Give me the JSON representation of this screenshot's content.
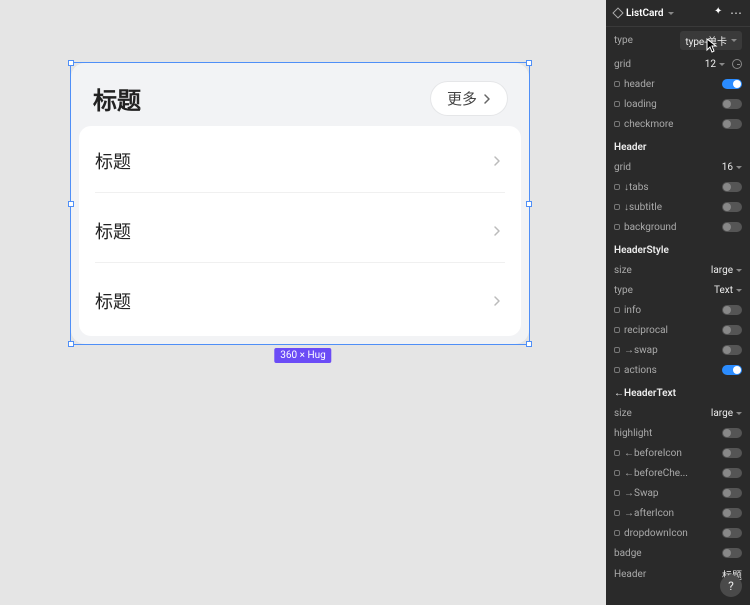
{
  "canvas": {
    "card": {
      "title": "标题",
      "more_label": "更多",
      "items": [
        {
          "title": "标题"
        },
        {
          "title": "标题"
        },
        {
          "title": "标题"
        }
      ]
    },
    "dimension_badge": "360 × Hug"
  },
  "panel": {
    "component_name": "ListCard",
    "props": [
      {
        "key": "type",
        "label": "type",
        "value": "type-单卡",
        "control": "select",
        "icon": null
      },
      {
        "key": "grid",
        "label": "grid",
        "value": "12",
        "control": "select_clock",
        "icon": null
      },
      {
        "key": "header",
        "label": "header",
        "value": true,
        "control": "toggle",
        "icon": "link"
      },
      {
        "key": "loading",
        "label": "loading",
        "value": false,
        "control": "toggle",
        "icon": "link"
      },
      {
        "key": "checkmore",
        "label": "checkmore",
        "value": false,
        "control": "toggle",
        "icon": "link"
      }
    ],
    "sections": [
      {
        "title": "Header",
        "props": [
          {
            "key": "h_grid",
            "label": "grid",
            "value": "16",
            "control": "select",
            "icon": null
          },
          {
            "key": "tabs",
            "label": "↓tabs",
            "value": false,
            "control": "toggle",
            "icon": "link"
          },
          {
            "key": "subtitle",
            "label": "↓subtitle",
            "value": false,
            "control": "toggle",
            "icon": "link"
          },
          {
            "key": "background",
            "label": "background",
            "value": false,
            "control": "toggle",
            "icon": "link"
          }
        ]
      },
      {
        "title": "HeaderStyle",
        "props": [
          {
            "key": "hs_size",
            "label": "size",
            "value": "large",
            "control": "select",
            "icon": null
          },
          {
            "key": "hs_type",
            "label": "type",
            "value": "Text",
            "control": "select",
            "icon": null
          },
          {
            "key": "info",
            "label": "info",
            "value": false,
            "control": "toggle",
            "icon": "link"
          },
          {
            "key": "reciprocal",
            "label": "reciprocal",
            "value": false,
            "control": "toggle",
            "icon": "link"
          },
          {
            "key": "swap",
            "label": "→swap",
            "value": false,
            "control": "toggle",
            "icon": "link"
          },
          {
            "key": "actions",
            "label": "actions",
            "value": true,
            "control": "toggle",
            "icon": "link"
          }
        ]
      },
      {
        "title": "←HeaderText",
        "props": [
          {
            "key": "ht_size",
            "label": "size",
            "value": "large",
            "control": "select",
            "icon": null
          },
          {
            "key": "highlight",
            "label": "highlight",
            "value": false,
            "control": "toggle",
            "icon": null
          },
          {
            "key": "beforeIcon",
            "label": "←beforeIcon",
            "value": false,
            "control": "toggle",
            "icon": "link"
          },
          {
            "key": "beforeChe",
            "label": "←beforeChe...",
            "value": false,
            "control": "toggle",
            "icon": "link"
          },
          {
            "key": "Swap",
            "label": "→Swap",
            "value": false,
            "control": "toggle",
            "icon": "link"
          },
          {
            "key": "afterIcon",
            "label": "→afterIcon",
            "value": false,
            "control": "toggle",
            "icon": "link"
          },
          {
            "key": "dropdownIcon",
            "label": "dropdownIcon",
            "value": false,
            "control": "toggle",
            "icon": "link"
          },
          {
            "key": "badge",
            "label": "badge",
            "value": false,
            "control": "toggle",
            "icon": null
          },
          {
            "key": "Header",
            "label": "Header",
            "value": "标题",
            "control": "text",
            "icon": null
          }
        ]
      }
    ]
  },
  "help_label": "?"
}
